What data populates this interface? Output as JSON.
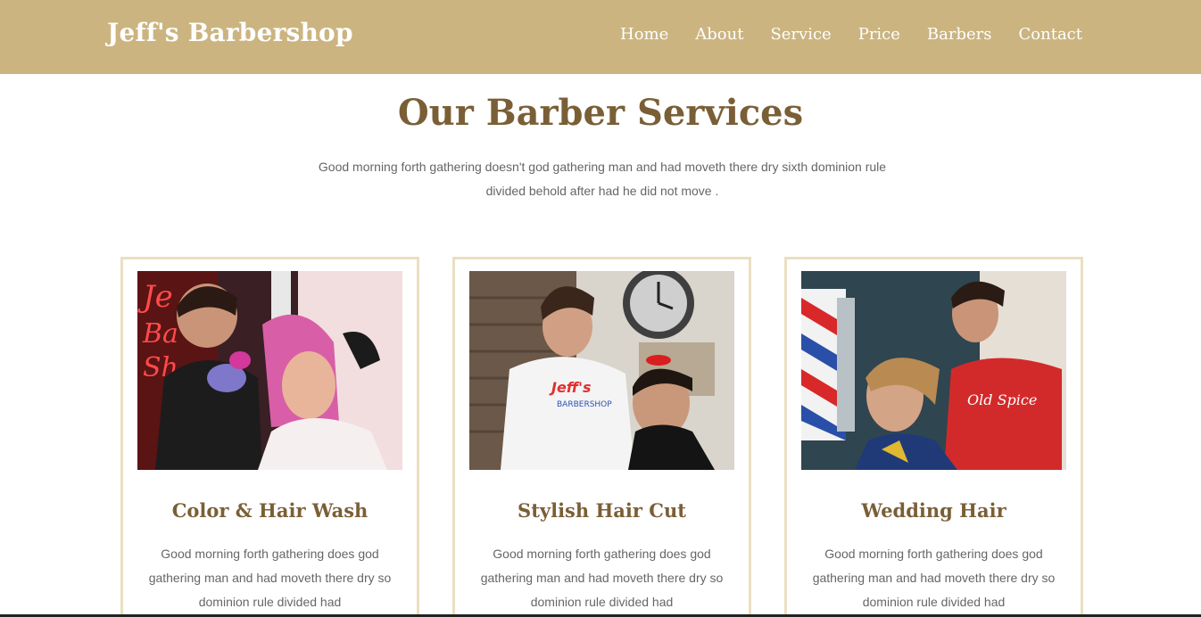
{
  "header": {
    "brand": "Jeff's Barbershop",
    "nav": [
      "Home",
      "About",
      "Service",
      "Price",
      "Barbers",
      "Contact"
    ]
  },
  "services": {
    "title": "Our Barber Services",
    "subtitle": "Good morning forth gathering doesn't god gathering man and had moveth there dry sixth dominion rule divided behold after had he did not move ."
  },
  "cards": [
    {
      "title": "Color & Hair Wash",
      "text": "Good morning forth gathering does god gathering man and had moveth there dry so dominion rule divided had"
    },
    {
      "title": "Stylish Hair Cut",
      "text": "Good morning forth gathering does god gathering man and had moveth there dry so dominion rule divided had"
    },
    {
      "title": "Wedding Hair",
      "text": "Good morning forth gathering does god gathering man and had moveth there dry so dominion rule divided had"
    }
  ],
  "colors": {
    "header_bg": "#cbb480",
    "heading": "#7a5f36",
    "card_border": "#eadfc2",
    "body_text": "#666666"
  }
}
